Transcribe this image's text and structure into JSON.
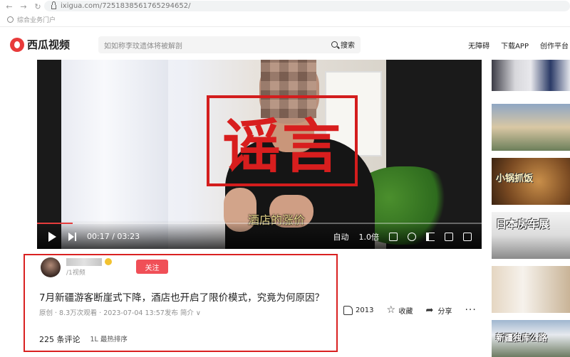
{
  "browser": {
    "url": "ixigua.com/7251838561765294652/",
    "bookmark": "综合业务门户"
  },
  "header": {
    "logo": "西瓜视频",
    "search_placeholder": "如如称李玟遗体将被解剖",
    "search_button": "搜索",
    "links": [
      "无障碍",
      "下载APP",
      "创作平台"
    ]
  },
  "player": {
    "stamp": "谣言",
    "subtitle": "酒店的涨价",
    "current_time": "00:17",
    "duration": "03:23",
    "time_display": "00:17 / 03:23",
    "progress": 0.08,
    "auto_label": "自动",
    "speed_label": "1.0倍"
  },
  "author": {
    "fans": "/1视频",
    "follow": "关注"
  },
  "video": {
    "title": "7月新疆游客断崖式下降，酒店也开启了限价模式，究竟为何原因？",
    "meta": "原创 · 8.3万次观看 · 2023-07-04 13:57发布 简介 ∨"
  },
  "comments": {
    "count": "225 条评论",
    "sort": "1L 最热排序"
  },
  "actions": {
    "likes": "2013",
    "favorite": "收藏",
    "share": "分享"
  },
  "sidebar": {
    "thumb_labels": [
      "",
      "",
      "小锅抓饭",
      "日本房车展",
      "",
      "新疆独库公路"
    ]
  },
  "colors": {
    "brand_red": "#e83a3a",
    "rumor_red": "#d81e1e",
    "follow_button": "#f04f57",
    "highlight_border": "#d92121"
  }
}
